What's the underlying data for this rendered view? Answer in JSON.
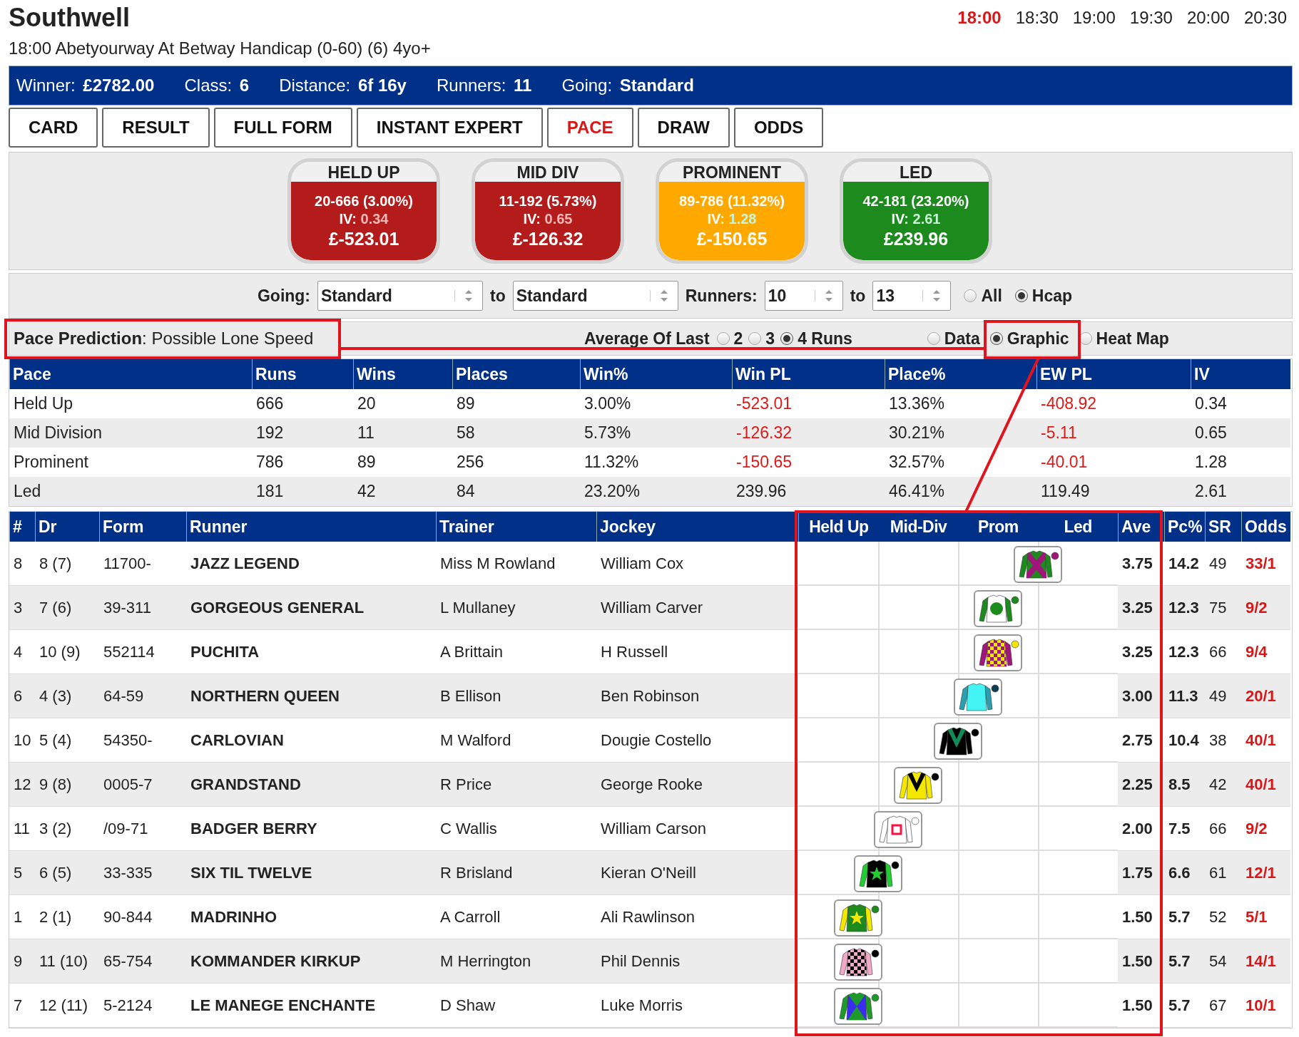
{
  "course": "Southwell",
  "times": [
    {
      "label": "18:00",
      "selected": true
    },
    {
      "label": "18:30",
      "selected": false
    },
    {
      "label": "19:00",
      "selected": false
    },
    {
      "label": "19:30",
      "selected": false
    },
    {
      "label": "20:00",
      "selected": false
    },
    {
      "label": "20:30",
      "selected": false
    }
  ],
  "race_title": "18:00 Abetyourway At Betway Handicap (0-60) (6) 4yo+",
  "info_bar": [
    {
      "label": "Winner:",
      "value": "£2782.00"
    },
    {
      "label": "Class:",
      "value": "6"
    },
    {
      "label": "Distance:",
      "value": "6f 16y"
    },
    {
      "label": "Runners:",
      "value": "11"
    },
    {
      "label": "Going:",
      "value": "Standard"
    }
  ],
  "tabs": [
    {
      "label": "CARD",
      "selected": false
    },
    {
      "label": "RESULT",
      "selected": false
    },
    {
      "label": "FULL FORM",
      "selected": false
    },
    {
      "label": "INSTANT EXPERT",
      "selected": false
    },
    {
      "label": "PACE",
      "selected": true
    },
    {
      "label": "DRAW",
      "selected": false
    },
    {
      "label": "ODDS",
      "selected": false
    }
  ],
  "pace_cards": [
    {
      "title": "HELD UP",
      "record": "20-666 (3.00%)",
      "iv_label": "IV:",
      "iv": "0.34",
      "iv_good": false,
      "pl": "£-523.01",
      "color": "#b41c1c"
    },
    {
      "title": "MID DIV",
      "record": "11-192 (5.73%)",
      "iv_label": "IV:",
      "iv": "0.65",
      "iv_good": false,
      "pl": "£-126.32",
      "color": "#b41c1c"
    },
    {
      "title": "PROMINENT",
      "record": "89-786 (11.32%)",
      "iv_label": "IV:",
      "iv": "1.28",
      "iv_good": true,
      "pl": "£-150.65",
      "color": "#ffa800"
    },
    {
      "title": "LED",
      "record": "42-181 (23.20%)",
      "iv_label": "IV:",
      "iv": "2.61",
      "iv_good": true,
      "pl": "£239.96",
      "color": "#1d8a1d"
    }
  ],
  "filters": {
    "going_label": "Going:",
    "going_from": "Standard",
    "to_label_1": "to",
    "going_to": "Standard",
    "runners_label": "Runners:",
    "runners_from": "10",
    "to_label_2": "to",
    "runners_to": "13",
    "race_type": [
      {
        "label": "All",
        "selected": false
      },
      {
        "label": "Hcap",
        "selected": true
      }
    ]
  },
  "pace_prediction": "**Pace Prediction**: Possible Lone Speed",
  "average_label": "Average Of Last",
  "average_options": [
    {
      "label": "2",
      "selected": false
    },
    {
      "label": "3",
      "selected": false
    },
    {
      "label": "4 Runs",
      "selected": true
    }
  ],
  "view_options": [
    {
      "label": "Data",
      "selected": false
    },
    {
      "label": "Graphic",
      "selected": true
    },
    {
      "label": "Heat Map",
      "selected": false
    }
  ],
  "stats_table": {
    "columns": [
      "Pace",
      "Runs",
      "Wins",
      "Places",
      "Win%",
      "Win PL",
      "Place%",
      "EW PL",
      "IV"
    ],
    "rows": [
      {
        "pace": "Held Up",
        "runs": "666",
        "wins": "20",
        "places": "89",
        "win_pct": "3.00%",
        "win_pl": {
          "text": "-523.01",
          "negative": true
        },
        "place_pct": "13.36%",
        "ew_pl": {
          "text": "-408.92",
          "negative": true
        },
        "iv": "0.34"
      },
      {
        "pace": "Mid Division",
        "runs": "192",
        "wins": "11",
        "places": "58",
        "win_pct": "5.73%",
        "win_pl": {
          "text": "-126.32",
          "negative": true
        },
        "place_pct": "30.21%",
        "ew_pl": {
          "text": "-5.11",
          "negative": true
        },
        "iv": "0.65"
      },
      {
        "pace": "Prominent",
        "runs": "786",
        "wins": "89",
        "places": "256",
        "win_pct": "11.32%",
        "win_pl": {
          "text": "-150.65",
          "negative": true
        },
        "place_pct": "32.57%",
        "ew_pl": {
          "text": "-40.01",
          "negative": true
        },
        "iv": "1.28"
      },
      {
        "pace": "Led",
        "runs": "181",
        "wins": "42",
        "places": "84",
        "win_pct": "23.20%",
        "win_pl": {
          "text": "239.96",
          "negative": false
        },
        "place_pct": "46.41%",
        "ew_pl": {
          "text": "119.49",
          "negative": false
        },
        "iv": "2.61"
      }
    ]
  },
  "runners_table": {
    "columns": [
      "#",
      "Dr",
      "Form",
      "Runner",
      "Trainer",
      "Jockey"
    ],
    "pace_columns": [
      "Held Up",
      "Mid-Div",
      "Prom",
      "Led"
    ],
    "end_columns": [
      "Ave",
      "Pc%",
      "SR",
      "Odds"
    ],
    "rows": [
      {
        "num": "8",
        "draw": "8 (7)",
        "form": "11700-",
        "runner": "JAZZ LEGEND",
        "trainer": "Miss M Rowland",
        "jockey": "William Cox",
        "ave": "3.75",
        "pc": "14.2",
        "sr": "49",
        "odds": "33/1"
      },
      {
        "num": "3",
        "draw": "7 (6)",
        "form": "39-311",
        "runner": "GORGEOUS GENERAL",
        "trainer": "L Mullaney",
        "jockey": "William Carver",
        "ave": "3.25",
        "pc": "12.3",
        "sr": "75",
        "odds": "9/2"
      },
      {
        "num": "4",
        "draw": "10 (9)",
        "form": "552114",
        "runner": "PUCHITA",
        "trainer": "A Brittain",
        "jockey": "H Russell",
        "ave": "3.25",
        "pc": "12.3",
        "sr": "66",
        "odds": "9/4"
      },
      {
        "num": "6",
        "draw": "4 (3)",
        "form": "64-59",
        "runner": "NORTHERN QUEEN",
        "trainer": "B Ellison",
        "jockey": "Ben Robinson",
        "ave": "3.00",
        "pc": "11.3",
        "sr": "49",
        "odds": "20/1"
      },
      {
        "num": "10",
        "draw": "5 (4)",
        "form": "54350-",
        "runner": "CARLOVIAN",
        "trainer": "M Walford",
        "jockey": "Dougie Costello",
        "ave": "2.75",
        "pc": "10.4",
        "sr": "38",
        "odds": "40/1"
      },
      {
        "num": "12",
        "draw": "9 (8)",
        "form": "0005-7",
        "runner": "GRANDSTAND",
        "trainer": "R Price",
        "jockey": "George Rooke",
        "ave": "2.25",
        "pc": "8.5",
        "sr": "42",
        "odds": "40/1"
      },
      {
        "num": "11",
        "draw": "3 (2)",
        "form": "/09-71",
        "runner": "BADGER BERRY",
        "trainer": "C Wallis",
        "jockey": "William Carson",
        "ave": "2.00",
        "pc": "7.5",
        "sr": "66",
        "odds": "9/2"
      },
      {
        "num": "5",
        "draw": "6 (5)",
        "form": "33-335",
        "runner": "SIX TIL TWELVE",
        "trainer": "R Brisland",
        "jockey": "Kieran O'Neill",
        "ave": "1.75",
        "pc": "6.6",
        "sr": "61",
        "odds": "12/1"
      },
      {
        "num": "1",
        "draw": "2 (1)",
        "form": "90-844",
        "runner": "MADRINHO",
        "trainer": "A Carroll",
        "jockey": "Ali Rawlinson",
        "ave": "1.50",
        "pc": "5.7",
        "sr": "52",
        "odds": "5/1"
      },
      {
        "num": "9",
        "draw": "11 (10)",
        "form": "65-754",
        "runner": "KOMMANDER KIRKUP",
        "trainer": "M Herrington",
        "jockey": "Phil Dennis",
        "ave": "1.50",
        "pc": "5.7",
        "sr": "54",
        "odds": "14/1"
      },
      {
        "num": "7",
        "draw": "12 (11)",
        "form": "5-2124",
        "runner": "LE MANEGE ENCHANTE",
        "trainer": "D Shaw",
        "jockey": "Luke Morris",
        "ave": "1.50",
        "pc": "5.7",
        "sr": "67",
        "odds": "10/1"
      }
    ]
  }
}
